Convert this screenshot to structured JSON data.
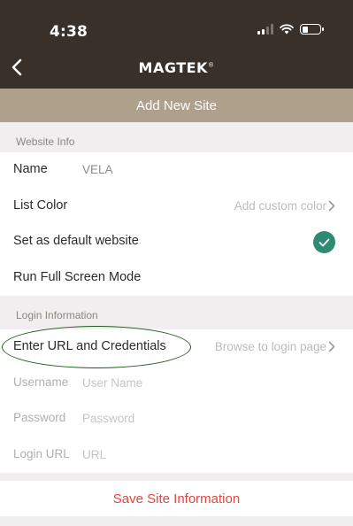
{
  "status_bar": {
    "time": "4:38"
  },
  "nav": {
    "back_icon": "chevron-left-icon",
    "brand": "MAGTEK",
    "brand_mark": "®"
  },
  "header": {
    "title": "Add New Site"
  },
  "website_info": {
    "section_title": "Website Info",
    "name_label": "Name",
    "name_value": "VELA",
    "list_color_label": "List Color",
    "list_color_placeholder": "Add custom color",
    "default_label": "Set as default website",
    "default_checked": true,
    "fullscreen_label": "Run Full Screen Mode"
  },
  "login_info": {
    "section_title": "Login Information",
    "enter_url_label": "Enter URL and Credentials",
    "browse_label": "Browse to login page",
    "username_label": "Username",
    "username_placeholder": "User Name",
    "password_label": "Password",
    "password_placeholder": "Password",
    "login_url_label": "Login URL",
    "login_url_placeholder": "URL"
  },
  "actions": {
    "save_label": "Save Site Information"
  },
  "colors": {
    "topbar": "#3a302a",
    "title_band": "#aea08a",
    "check": "#2f8a72",
    "save": "#e2463f",
    "annotation_oval": "#1f5d1a"
  }
}
